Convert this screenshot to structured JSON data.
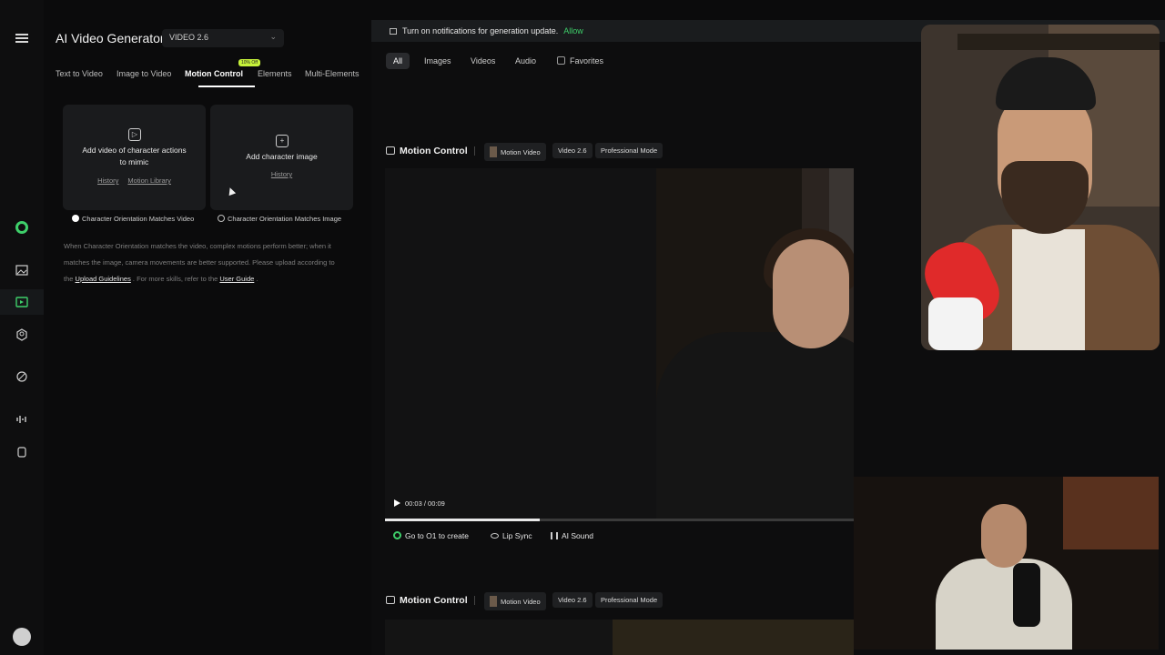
{
  "app": {
    "title": "AI Video Generator",
    "model": "VIDEO 2.6"
  },
  "tabs": [
    {
      "label": "Text to Video"
    },
    {
      "label": "Image to Video"
    },
    {
      "label": "Motion Control",
      "badge": "10% Off"
    },
    {
      "label": "Elements"
    },
    {
      "label": "Multi-Elements"
    }
  ],
  "upload": {
    "video_card": {
      "text": "Add video of character actions to mimic",
      "link_history": "History",
      "link_library": "Motion Library"
    },
    "image_card": {
      "text": "Add character image",
      "link_history": "History"
    },
    "option_video": "Character Orientation Matches Video",
    "option_image": "Character Orientation Matches Image",
    "hint_1": "When Character Orientation matches the video, complex motions perform better; when it matches the image, camera movements are better supported. Please upload according to the",
    "hint_link_1": "Upload Guidelines",
    "hint_2": ". For more skills, refer to the",
    "hint_link_2": "User Guide",
    "hint_3": "."
  },
  "notification": {
    "text": "Turn on notifications for generation update.",
    "action": "Allow"
  },
  "filters": {
    "all": "All",
    "images": "Images",
    "videos": "Videos",
    "audio": "Audio",
    "favorites": "Favorites"
  },
  "generation": {
    "title": "Motion Control",
    "tag_source": "Motion Video",
    "tag_model": "Video 2.6",
    "tag_mode": "Professional Mode",
    "time": "00:03 / 00:09",
    "progress": 0.33,
    "action_o1": "Go to O1 to create",
    "action_lipsync": "Lip Sync",
    "action_sound": "AI Sound"
  },
  "colors": {
    "accent_green": "#3ecf6a",
    "offer_badge": "#c6f23a"
  }
}
